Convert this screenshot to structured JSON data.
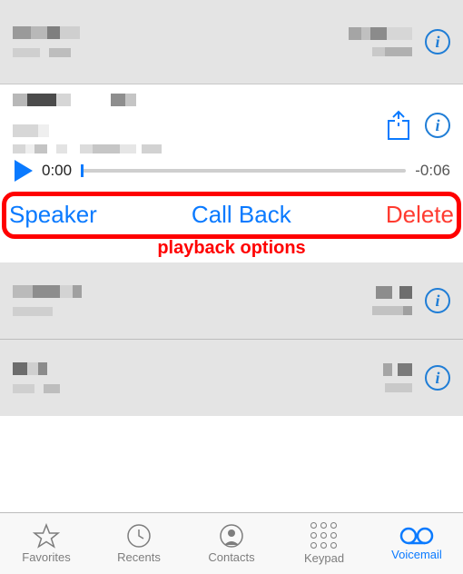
{
  "list": {
    "rows": [
      {
        "id": 0
      },
      {
        "id": 1,
        "expanded": true
      },
      {
        "id": 2
      },
      {
        "id": 3
      }
    ]
  },
  "playback": {
    "current_time": "0:00",
    "remaining_time": "-0:06"
  },
  "actions": {
    "speaker": "Speaker",
    "callback": "Call Back",
    "delete": "Delete"
  },
  "annotation": {
    "label": "playback options"
  },
  "tabs": {
    "favorites": "Favorites",
    "recents": "Recents",
    "contacts": "Contacts",
    "keypad": "Keypad",
    "voicemail": "Voicemail"
  },
  "colors": {
    "accent": "#0a7aff",
    "destructive": "#ff3b30",
    "highlight_ring": "#ff0000"
  }
}
